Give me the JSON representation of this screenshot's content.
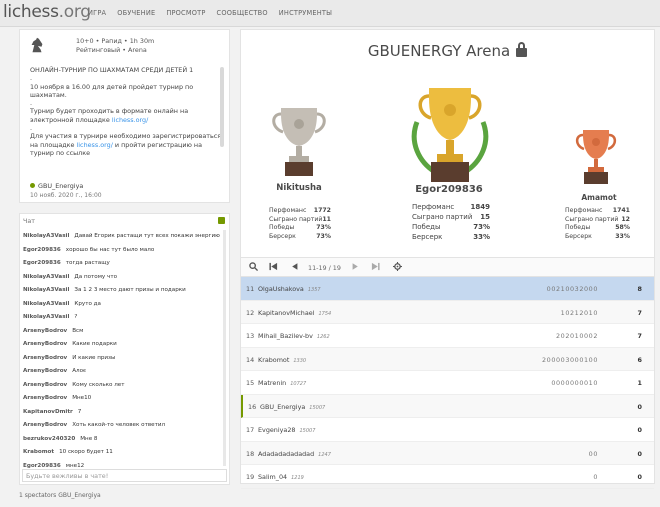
{
  "header": {
    "logo_main": "lichess",
    "logo_tld": ".org",
    "nav": [
      "ИГРА",
      "ОБУЧЕНИЕ",
      "ПРОСМОТР",
      "СООБЩЕСТВО",
      "ИНСТРУМЕНТЫ"
    ]
  },
  "info": {
    "meta_line1": "10+0 • Рапид • 1h 30m",
    "meta_line2": "Рейтинговый • Arena",
    "description": [
      "ОНЛАЙН-ТУРНИР ПО ШАХМАТАМ СРЕДИ ДЕТЕЙ 1",
      ".",
      "10 ноября в 16.00 для детей пройдет турнир по шахматам.",
      ".",
      "Турнир будет проходить в формате онлайн на электронной площадке",
      "Для участия в турнире необходимо зарегистрироваться на площадке",
      "и пройти регистрацию на турнир по ссылке"
    ],
    "link": "lichess.org/",
    "creator": "GBU_Energiya",
    "created": "10 нояб. 2020 г., 16:00"
  },
  "chat": {
    "title": "Чат",
    "input_placeholder": "Будьте вежливы в чате!",
    "messages": [
      {
        "user": "NikolayA3Vasil",
        "text": "Давай Егорик растащи тут всех покажи энергию"
      },
      {
        "user": "Egor209836",
        "text": "хорошо бы нас тут было мало"
      },
      {
        "user": "Egor209836",
        "text": "тогда растащу"
      },
      {
        "user": "NikolayA3Vasil",
        "text": "Да потому что"
      },
      {
        "user": "NikolayA3Vasil",
        "text": "За 1 2 3 место дают призы и подарки"
      },
      {
        "user": "NikolayA3Vasil",
        "text": "Круто да"
      },
      {
        "user": "NikolayA3Vasil",
        "text": "?"
      },
      {
        "user": "ArsenyBodrov",
        "text": "Всм"
      },
      {
        "user": "ArsenyBodrov",
        "text": "Какие подарки"
      },
      {
        "user": "ArsenyBodrov",
        "text": "И какие призы"
      },
      {
        "user": "ArsenyBodrov",
        "text": "Алоє"
      },
      {
        "user": "ArsenyBodrov",
        "text": "Кому сколько лет"
      },
      {
        "user": "ArsenyBodrov",
        "text": "Мне10"
      },
      {
        "user": "KapitanovDmitr",
        "text": "7"
      },
      {
        "user": "ArsenyBodrov",
        "text": "Хоть какой-то человек ответил"
      },
      {
        "user": "bezrukov240320",
        "text": "Мне 8"
      },
      {
        "user": "Krabomot",
        "text": "10 скоро будет 11"
      },
      {
        "user": "Egor209836",
        "text": "мне12"
      }
    ]
  },
  "spectators": "1 spectators GBU_Energiya",
  "arena": {
    "title": "GBUENERGY Arena"
  },
  "podium": [
    {
      "place": 2,
      "name": "Nikitusha",
      "color": "#b9b3a9",
      "stats": [
        [
          "Перфоманс",
          "1772"
        ],
        [
          "Сыграно партий",
          "11"
        ],
        [
          "Победы",
          "73%"
        ],
        [
          "Берсерк",
          "73%"
        ]
      ]
    },
    {
      "place": 1,
      "name": "Egor209836",
      "color": "#e7b53a",
      "stats": [
        [
          "Перфоманс",
          "1849"
        ],
        [
          "Сыграно партий",
          "15"
        ],
        [
          "Победы",
          "73%"
        ],
        [
          "Берсерк",
          "33%"
        ]
      ]
    },
    {
      "place": 3,
      "name": "Amamot",
      "color": "#e0774b",
      "stats": [
        [
          "Перфоманс",
          "1741"
        ],
        [
          "Сыграно партий",
          "12"
        ],
        [
          "Победы",
          "58%"
        ],
        [
          "Берсерк",
          "33%"
        ]
      ]
    }
  ],
  "toolbar": {
    "pager": "11-19 / 19"
  },
  "standings": [
    {
      "rank": "11",
      "name": "OlgaUshakova",
      "rating": "1357",
      "sheet": "00210032000",
      "score": "8",
      "selected": true
    },
    {
      "rank": "12",
      "name": "KapitanovMichael",
      "rating": "1754",
      "sheet": "10212010",
      "score": "7"
    },
    {
      "rank": "13",
      "name": "Mihail_Bazilev-bv",
      "rating": "1262",
      "sheet": "202010002",
      "score": "7"
    },
    {
      "rank": "14",
      "name": "Krabomot",
      "rating": "1330",
      "sheet": "200003000100",
      "score": "6"
    },
    {
      "rank": "15",
      "name": "Matrenin",
      "rating": "10727",
      "sheet": "0000000010",
      "score": "1"
    },
    {
      "rank": "16",
      "name": "GBU_Energiya",
      "rating": "15007",
      "sheet": "",
      "score": "0",
      "me": true
    },
    {
      "rank": "17",
      "name": "Evgeniya28",
      "rating": "15007",
      "sheet": "",
      "score": "0"
    },
    {
      "rank": "18",
      "name": "Adadadadadadad",
      "rating": "1247",
      "sheet": "00",
      "score": "0"
    },
    {
      "rank": "19",
      "name": "Salim_04",
      "rating": "1219",
      "sheet": "0",
      "score": "0"
    }
  ]
}
